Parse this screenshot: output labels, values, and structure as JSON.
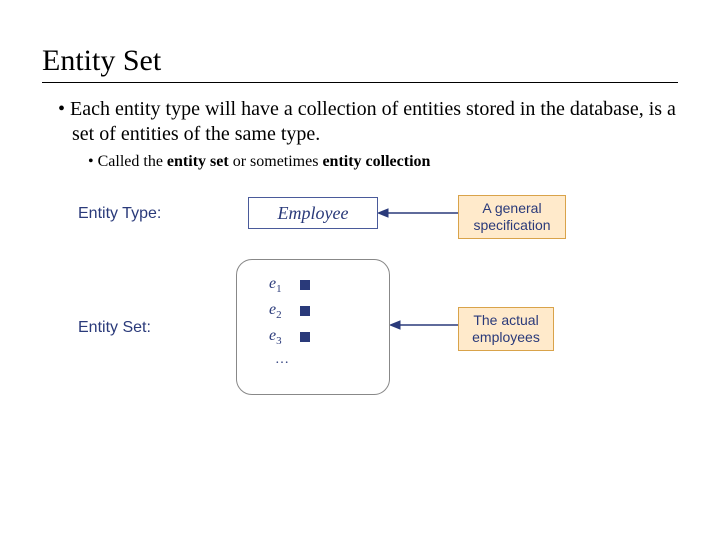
{
  "title": "Entity Set",
  "bullets": {
    "main": "Each entity type will have a collection of entities stored in the database, is a set of entities of the same type.",
    "sub_pre": "Called the ",
    "sub_b1": "entity set",
    "sub_mid": " or sometimes ",
    "sub_b2": "entity collection"
  },
  "diagram": {
    "label_type": "Entity Type:",
    "label_set": "Entity Set:",
    "type_box": "Employee",
    "entities": {
      "e1": "e",
      "e1s": "1",
      "e2": "e",
      "e2s": "2",
      "e3": "e",
      "e3s": "3",
      "dots": "…"
    },
    "callout1_l1": "A general",
    "callout1_l2": "specification",
    "callout2_l1": "The actual",
    "callout2_l2": "employees"
  }
}
